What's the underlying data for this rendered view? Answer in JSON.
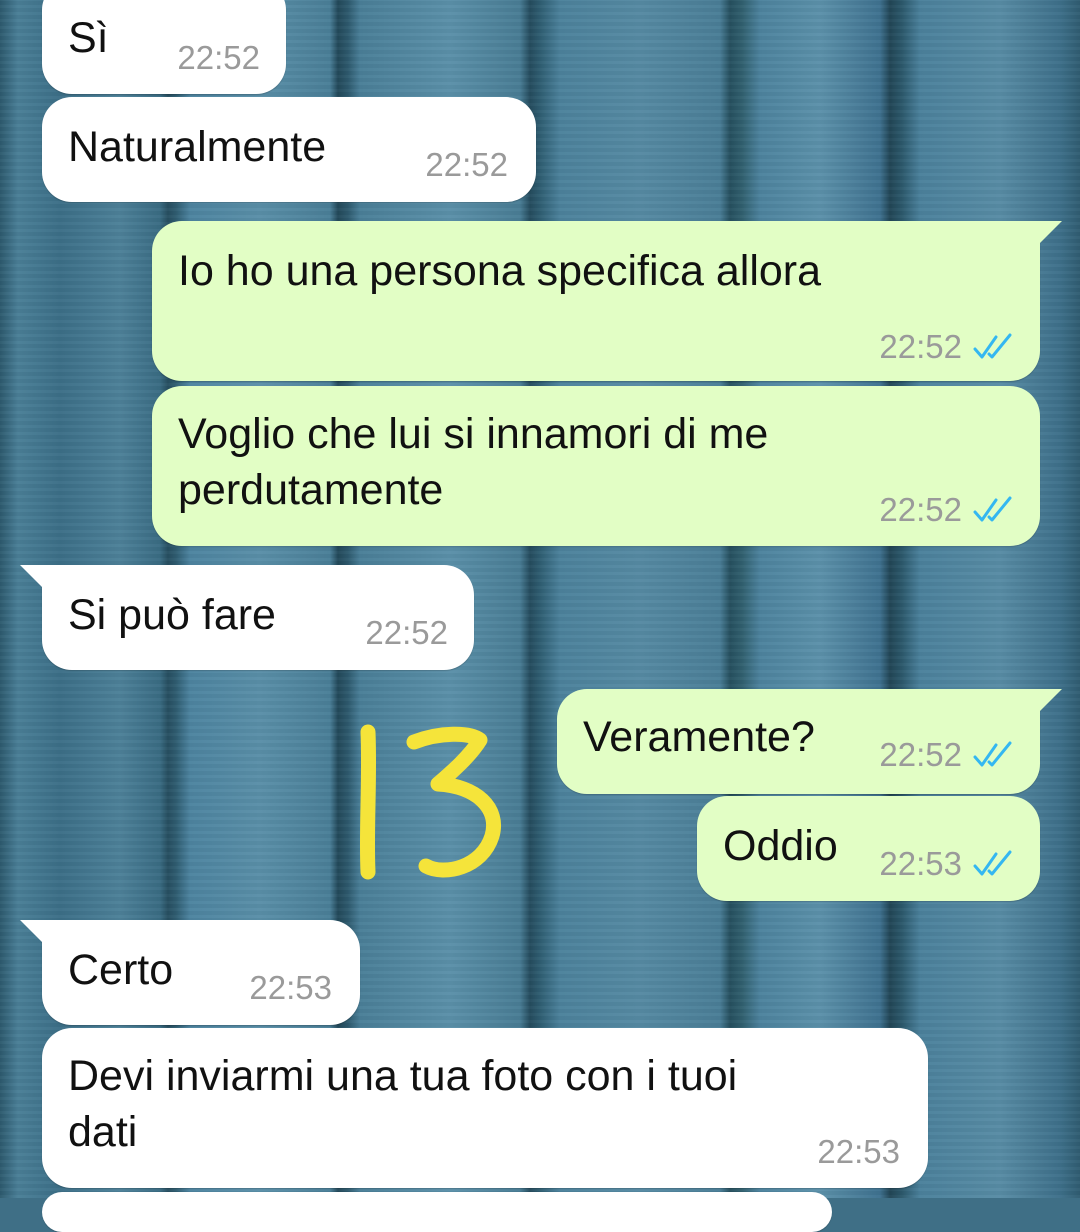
{
  "conversation": {
    "messages": [
      {
        "direction": "incoming",
        "text": "Sì",
        "time": "22:52"
      },
      {
        "direction": "incoming",
        "text": "Naturalmente",
        "time": "22:52"
      },
      {
        "direction": "outgoing",
        "text": "Io ho una persona specifica allora",
        "time": "22:52",
        "status": "read"
      },
      {
        "direction": "outgoing",
        "text": "Voglio che lui si innamori di me\nperdutamente",
        "time": "22:52",
        "status": "read"
      },
      {
        "direction": "incoming",
        "text": "Si può fare",
        "time": "22:52"
      },
      {
        "direction": "outgoing",
        "text": "Veramente?",
        "time": "22:52",
        "status": "read"
      },
      {
        "direction": "outgoing",
        "text": "Oddio",
        "time": "22:53",
        "status": "read"
      },
      {
        "direction": "incoming",
        "text": "Certo",
        "time": "22:53"
      },
      {
        "direction": "incoming",
        "text": "Devi inviarmi una tua foto con i tuoi\ndati",
        "time": "22:53"
      }
    ]
  },
  "annotation": {
    "text": "13",
    "color": "#f5e43a"
  },
  "colors": {
    "incoming_bubble": "#ffffff",
    "outgoing_bubble": "#e2fec5",
    "read_ticks": "#34b7f1",
    "timestamp": "#9a9a9a"
  },
  "icons": {
    "read_receipt": "double-check-icon"
  }
}
